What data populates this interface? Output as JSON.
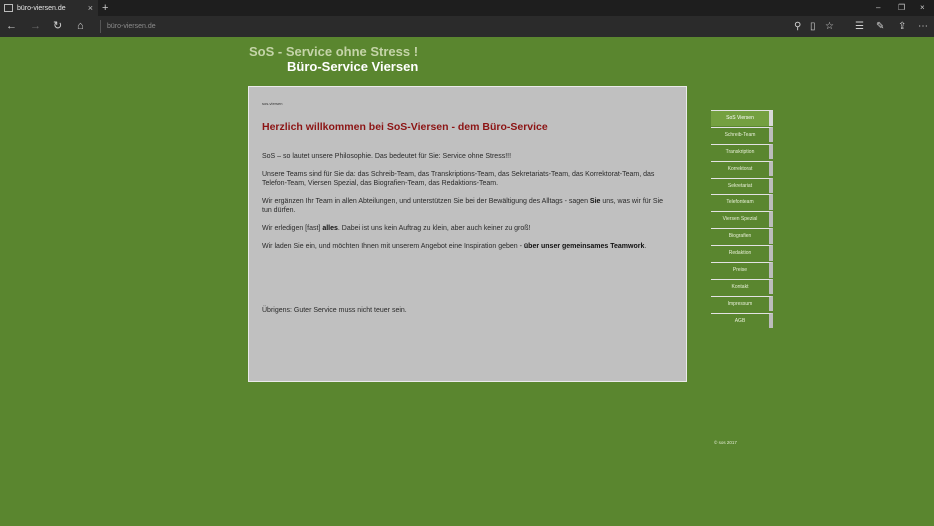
{
  "browser": {
    "tab_title": "büro-viersen.de",
    "tab_close": "×",
    "new_tab": "+",
    "address": "büro-viersen.de",
    "win": {
      "minimize": "–",
      "restore": "❐",
      "close": "×"
    }
  },
  "header": {
    "line1": "SoS - Service ohne Stress !",
    "line2": "Büro-Service Viersen"
  },
  "content": {
    "breadcrumb": "sos-viersen",
    "headline": "Herzlich willkommen bei SoS-Viersen - dem Büro-Service",
    "p1": "SoS – so lautet unsere Philosophie. Das bedeutet für Sie: Service ohne Stress!!!",
    "p2": "Unsere Teams sind für Sie da: das Schreib-Team, das Transkriptions-Team, das Sekretariats-Team, das Korrektorat-Team, das Telefon-Team, Viersen Spezial, das Biografien-Team, das Redaktions-Team.",
    "p3a": "Wir ergänzen Ihr Team in allen Abteilungen, und unterstützen Sie bei der Bewältigung des Alltags - sagen ",
    "p3b": "Sie",
    "p3c": " uns, was wir für Sie tun dürfen.",
    "p4a": "Wir erledigen [fast] ",
    "p4b": "alles",
    "p4c": ". Dabei ist uns kein Auftrag zu klein, aber auch keiner zu groß!",
    "p5a": "Wir laden Sie ein, und möchten Ihnen mit unserem Angebot eine Inspiration geben - ",
    "p5b": "über unser gemeinsames Teamwork",
    "p5c": ".",
    "footer_text": "Übrigens: Guter Service muss nicht teuer sein."
  },
  "nav": {
    "items": [
      "SoS Viersen",
      "Schreib-Team",
      "Transkription",
      "Korrektorat",
      "Sekretariat",
      "Telefonteam",
      "Viersen Spezial",
      "Biografien",
      "Redaktion",
      "Preise",
      "Kontakt",
      "Impressum",
      "AGB"
    ]
  },
  "copyright": "© sos 2017"
}
